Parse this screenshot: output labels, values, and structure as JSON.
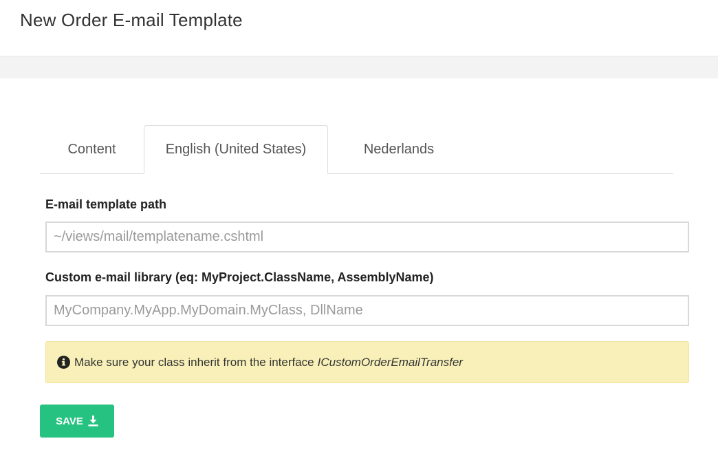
{
  "header": {
    "title": "New Order E-mail Template"
  },
  "tabs": [
    {
      "label": "Content",
      "active": false
    },
    {
      "label": "English (United States)",
      "active": true
    },
    {
      "label": "Nederlands",
      "active": false
    }
  ],
  "form": {
    "template_path": {
      "label": "E-mail template path",
      "value": "",
      "placeholder": "~/views/mail/templatename.cshtml"
    },
    "custom_library": {
      "label": "Custom e-mail library (eq: MyProject.ClassName, AssemblyName)",
      "value": "",
      "placeholder": "MyCompany.MyApp.MyDomain.MyClass, DllName"
    }
  },
  "alert": {
    "icon": "info-circle-icon",
    "text": "Make sure your class inherit from the interface",
    "emphasis": "ICustomOrderEmailTransfer"
  },
  "save_button": {
    "label": "SAVE",
    "icon": "download-icon"
  },
  "colors": {
    "save_green": "#26c281",
    "alert_bg": "#f8f0b8",
    "band_gray": "#f3f3f4"
  }
}
